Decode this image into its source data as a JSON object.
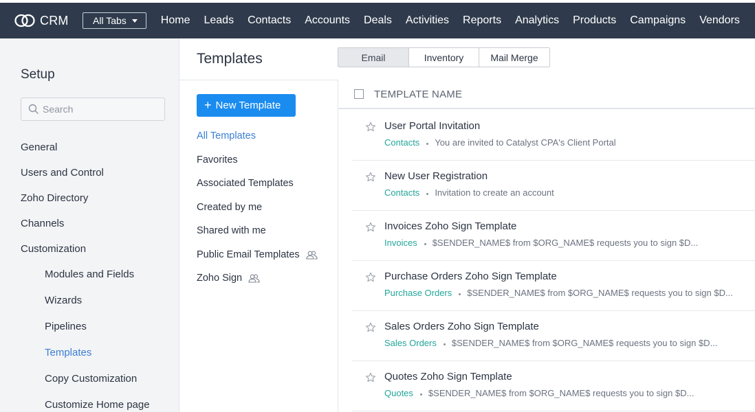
{
  "topbar": {
    "app_name": "CRM",
    "all_tabs_label": "All Tabs",
    "nav": [
      "Home",
      "Leads",
      "Contacts",
      "Accounts",
      "Deals",
      "Activities",
      "Reports",
      "Analytics",
      "Products",
      "Campaigns",
      "Vendors"
    ]
  },
  "setup": {
    "title": "Setup",
    "search_placeholder": "Search",
    "menu": [
      "General",
      "Users and Control",
      "Zoho Directory",
      "Channels",
      "Customization"
    ],
    "submenu": [
      "Modules and Fields",
      "Wizards",
      "Pipelines",
      "Templates",
      "Copy Customization",
      "Customize Home page"
    ],
    "active_submenu": "Templates"
  },
  "main": {
    "page_title": "Templates",
    "tabs": [
      {
        "label": "Email",
        "active": true
      },
      {
        "label": "Inventory",
        "active": false
      },
      {
        "label": "Mail Merge",
        "active": false
      }
    ],
    "new_button_label": "New Template",
    "categories": [
      {
        "label": "All Templates",
        "active": true,
        "shared_icon": false
      },
      {
        "label": "Favorites",
        "active": false,
        "shared_icon": false
      },
      {
        "label": "Associated Templates",
        "active": false,
        "shared_icon": false
      },
      {
        "label": "Created by me",
        "active": false,
        "shared_icon": false
      },
      {
        "label": "Shared with me",
        "active": false,
        "shared_icon": false
      },
      {
        "label": "Public Email Templates",
        "active": false,
        "shared_icon": true
      },
      {
        "label": "Zoho Sign",
        "active": false,
        "shared_icon": true
      }
    ],
    "column_header": "TEMPLATE NAME",
    "templates": [
      {
        "name": "User Portal Invitation",
        "module": "Contacts",
        "subject": "You are invited to Catalyst CPA's Client Portal"
      },
      {
        "name": "New User Registration",
        "module": "Contacts",
        "subject": "Invitation to create an account"
      },
      {
        "name": "Invoices Zoho Sign Template",
        "module": "Invoices",
        "subject": "$SENDER_NAME$ from $ORG_NAME$ requests you to sign $D..."
      },
      {
        "name": "Purchase Orders Zoho Sign Template",
        "module": "Purchase Orders",
        "subject": "$SENDER_NAME$ from $ORG_NAME$ requests you to sign $D..."
      },
      {
        "name": "Sales Orders Zoho Sign Template",
        "module": "Sales Orders",
        "subject": "$SENDER_NAME$ from $ORG_NAME$ requests you to sign $D..."
      },
      {
        "name": "Quotes Zoho Sign Template",
        "module": "Quotes",
        "subject": "$SENDER_NAME$ from $ORG_NAME$ requests you to sign $D..."
      }
    ]
  },
  "colors": {
    "topbar": "#2f3b4c",
    "accent_blue": "#1a8cf0",
    "link_blue": "#3b7fd4",
    "module_teal": "#23a69a",
    "sidebar_bg": "#f3f4f6"
  }
}
